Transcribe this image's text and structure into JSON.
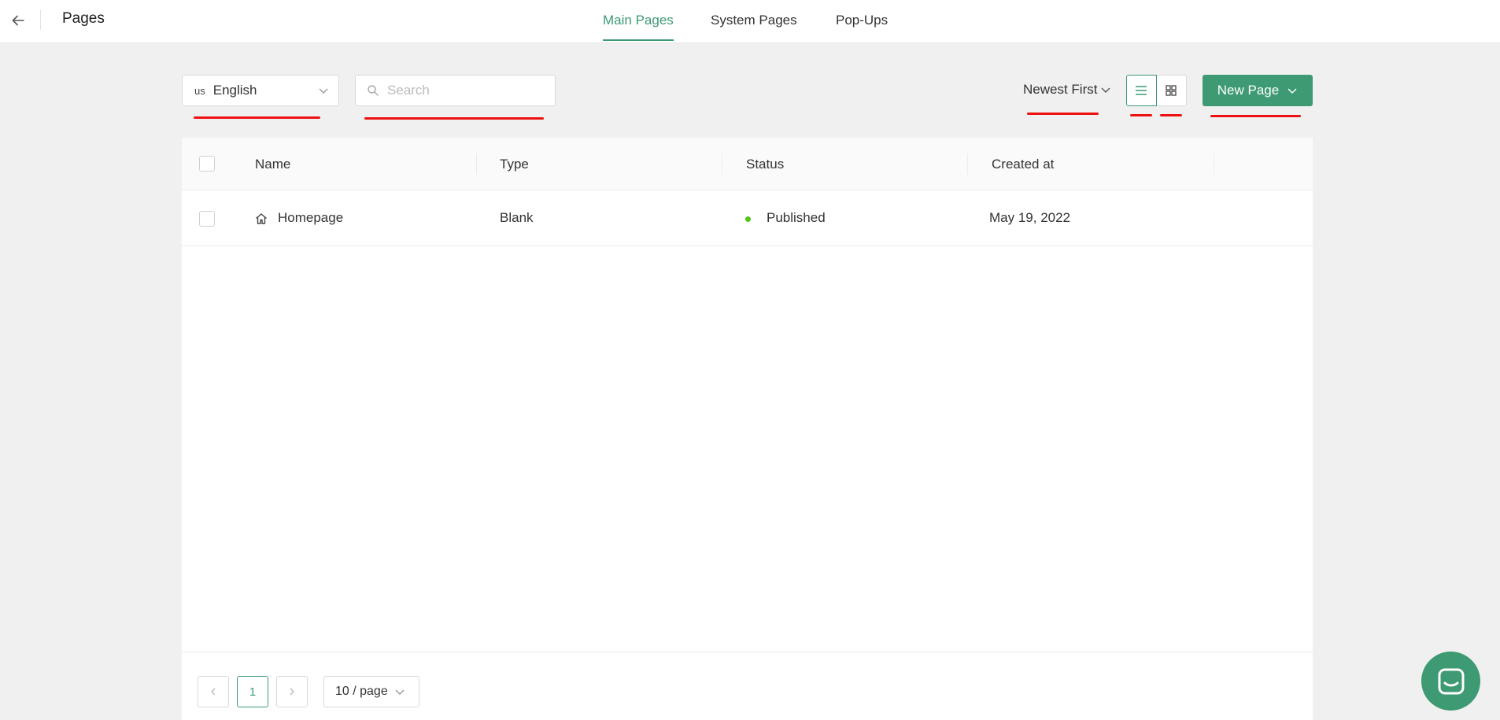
{
  "header": {
    "title": "Pages",
    "tabs": [
      {
        "label": "Main Pages",
        "active": true
      },
      {
        "label": "System Pages",
        "active": false
      },
      {
        "label": "Pop-Ups",
        "active": false
      }
    ]
  },
  "toolbar": {
    "language": {
      "code": "us",
      "label": "English"
    },
    "search": {
      "placeholder": "Search",
      "value": ""
    },
    "sort": {
      "label": "Newest First"
    },
    "view": {
      "selected": "list"
    },
    "new_page_label": "New Page"
  },
  "table": {
    "columns": [
      "Name",
      "Type",
      "Status",
      "Created at"
    ],
    "rows": [
      {
        "name": "Homepage",
        "type": "Blank",
        "status": "Published",
        "created_at": "May 19, 2022",
        "icon": "home-icon"
      }
    ]
  },
  "pagination": {
    "current_page": "1",
    "page_size": "10 / page"
  },
  "colors": {
    "accent": "#3d9a73",
    "status_published": "#52c41a",
    "annotation": "#ee1111"
  }
}
